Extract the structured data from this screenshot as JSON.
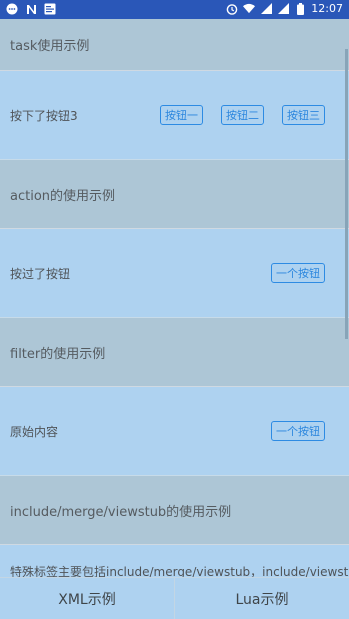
{
  "status_bar": {
    "time": "12:07",
    "left_icons": [
      "message-icon",
      "n-icon",
      "notification-icon"
    ],
    "right_icons": [
      "alarm-icon",
      "wifi-icon",
      "signal-icon",
      "signal-icon",
      "battery-icon"
    ]
  },
  "sections": [
    {
      "title": "task使用示例",
      "body_text": "按下了按钮3",
      "buttons": [
        "按钮一",
        "按钮二",
        "按钮三"
      ]
    },
    {
      "title": "action的使用示例",
      "body_text": "按过了按钮",
      "buttons": [
        "一个按钮"
      ]
    },
    {
      "title": "filter的使用示例",
      "body_text": "原始内容",
      "buttons": [
        "一个按钮"
      ]
    },
    {
      "title": "include/merge/viewstub的使用示例",
      "body_text": "特殊标签主要包括include/merge/viewstub，include/viewstub",
      "buttons": []
    }
  ],
  "bottom_bar": {
    "xml_label": "XML示例",
    "lua_label": "Lua示例"
  },
  "colors": {
    "status_bar": "#2a57b8",
    "header_bg": "#adc6d6",
    "body_bg": "#aed2f0",
    "button_border": "#2d8be3"
  }
}
